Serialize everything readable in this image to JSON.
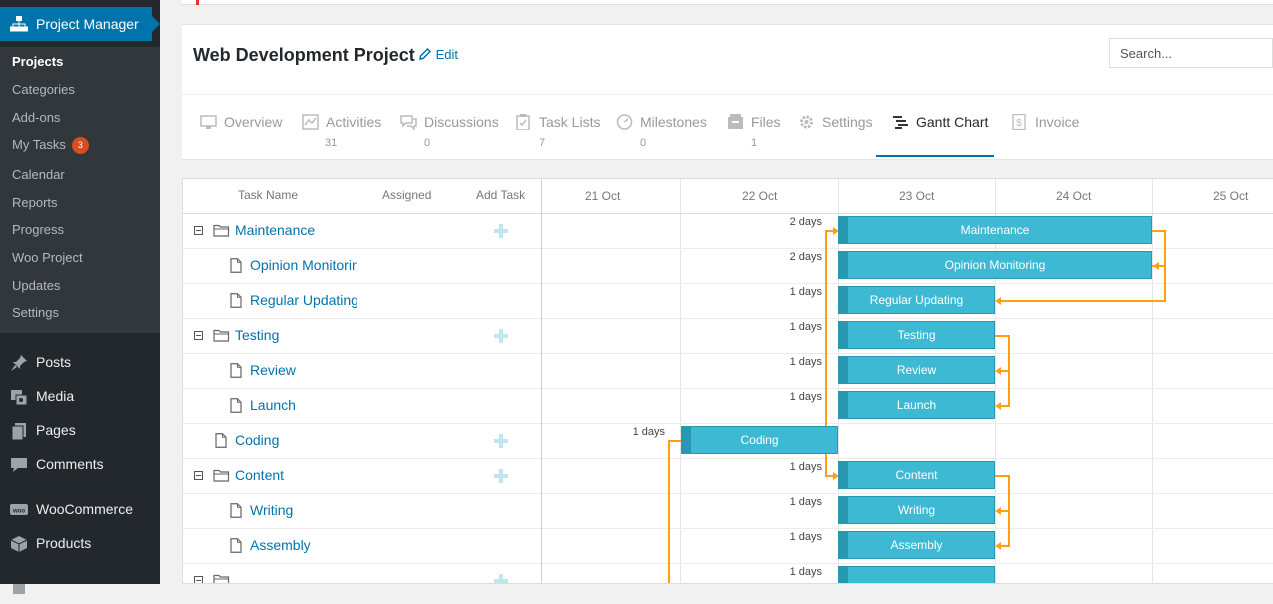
{
  "sidebar": {
    "plugin_title": "Project Manager",
    "submenu": [
      {
        "label": "Projects",
        "active": true
      },
      {
        "label": "Categories"
      },
      {
        "label": "Add-ons"
      },
      {
        "label": "My Tasks",
        "badge": "3"
      },
      {
        "label": "Calendar"
      },
      {
        "label": "Reports"
      },
      {
        "label": "Progress"
      },
      {
        "label": "Woo Project"
      },
      {
        "label": "Updates"
      },
      {
        "label": "Settings"
      }
    ],
    "menu": [
      {
        "label": "Posts",
        "icon": "pin-icon"
      },
      {
        "label": "Media",
        "icon": "media-icon"
      },
      {
        "label": "Pages",
        "icon": "pages-icon"
      },
      {
        "label": "Comments",
        "icon": "comments-icon"
      },
      {
        "label": "WooCommerce",
        "icon": "woocommerce-icon"
      },
      {
        "label": "Products",
        "icon": "products-icon"
      }
    ]
  },
  "project": {
    "title": "Web Development Project",
    "edit_label": "Edit",
    "search_placeholder": "Search..."
  },
  "tabs": [
    {
      "label": "Overview",
      "icon": "overview-icon",
      "count": ""
    },
    {
      "label": "Activities",
      "icon": "activities-icon",
      "count": "31"
    },
    {
      "label": "Discussions",
      "icon": "discussions-icon",
      "count": "0"
    },
    {
      "label": "Task Lists",
      "icon": "task-lists-icon",
      "count": "7"
    },
    {
      "label": "Milestones",
      "icon": "milestones-icon",
      "count": "0"
    },
    {
      "label": "Files",
      "icon": "files-icon",
      "count": "1"
    },
    {
      "label": "Settings",
      "icon": "settings-icon",
      "count": ""
    },
    {
      "label": "Gantt Chart",
      "icon": "gantt-icon",
      "count": "",
      "active": true
    },
    {
      "label": "Invoice",
      "icon": "invoice-icon",
      "count": ""
    }
  ],
  "gantt": {
    "columns": {
      "task_name": "Task Name",
      "assigned": "Assigned",
      "add_task": "Add Task"
    },
    "dates": [
      "21 Oct",
      "22 Oct",
      "23 Oct",
      "24 Oct",
      "25 Oct"
    ],
    "tasks": [
      {
        "name": "Maintenance",
        "type": "list",
        "start": "23 Oct",
        "duration_days": 2,
        "duration_label": "2 days"
      },
      {
        "name": "Opinion Monitoring",
        "type": "task",
        "start": "23 Oct",
        "duration_days": 2,
        "duration_label": "2 days"
      },
      {
        "name": "Regular Updating",
        "type": "task",
        "start": "23 Oct",
        "duration_days": 1,
        "duration_label": "1 days"
      },
      {
        "name": "Testing",
        "type": "list",
        "start": "23 Oct",
        "duration_days": 1,
        "duration_label": "1 days"
      },
      {
        "name": "Review",
        "type": "task",
        "start": "23 Oct",
        "duration_days": 1,
        "duration_label": "1 days"
      },
      {
        "name": "Launch",
        "type": "task",
        "start": "23 Oct",
        "duration_days": 1,
        "duration_label": "1 days"
      },
      {
        "name": "Coding",
        "type": "single",
        "start": "22 Oct",
        "duration_days": 1,
        "duration_label": "1 days"
      },
      {
        "name": "Content",
        "type": "list",
        "start": "23 Oct",
        "duration_days": 1,
        "duration_label": "1 days"
      },
      {
        "name": "Writing",
        "type": "task",
        "start": "23 Oct",
        "duration_days": 1,
        "duration_label": "1 days"
      },
      {
        "name": "Assembly",
        "type": "task",
        "start": "23 Oct",
        "duration_days": 1,
        "duration_label": "1 days"
      },
      {
        "name": "",
        "type": "list",
        "start": "23 Oct",
        "duration_days": 1,
        "duration_label": "1 days"
      }
    ],
    "colors": {
      "bar": "#3db9d3",
      "bar_border": "#2898b0",
      "link": "#ffa011"
    }
  }
}
